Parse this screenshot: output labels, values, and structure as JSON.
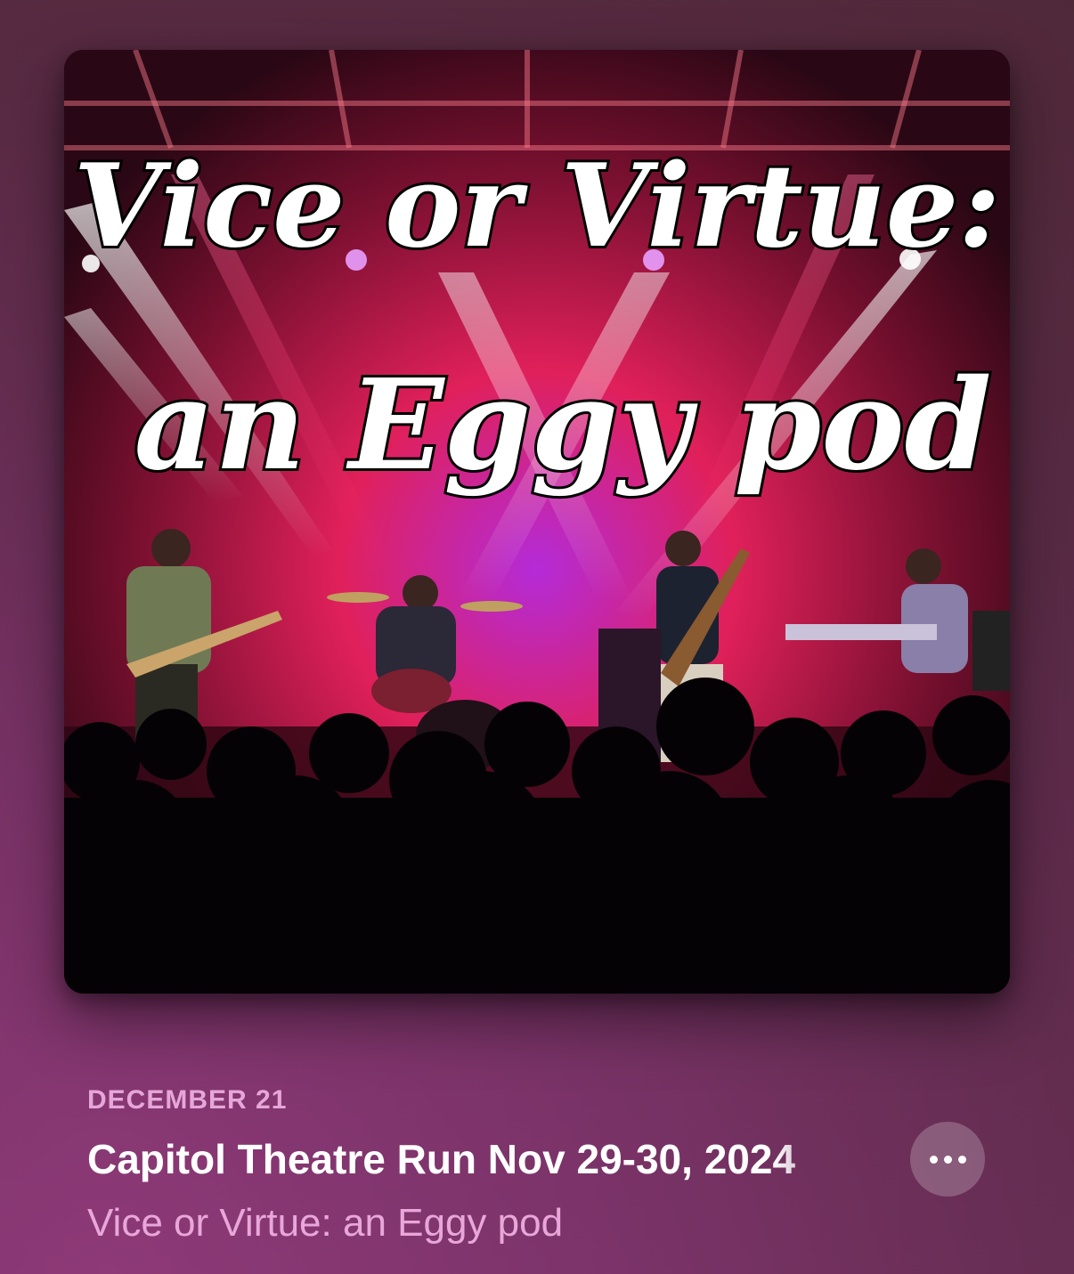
{
  "episode": {
    "date": "DECEMBER 21",
    "title": "Capitol Theatre Run Nov 29-30, 2024",
    "show_name": "Vice or Virtue: an Eggy pod"
  },
  "artwork": {
    "title_line_1": "Vice or Virtue:",
    "title_line_2": "an Eggy pod"
  },
  "controls": {
    "more_icon": "ellipsis-icon"
  },
  "colors": {
    "date": "#e6a7d8",
    "title": "#ffffff",
    "show_name": "#e8a7d8",
    "background": "#7a3368"
  }
}
